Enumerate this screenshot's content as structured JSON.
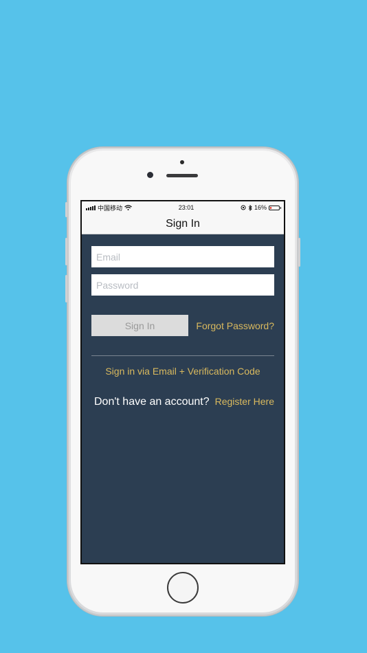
{
  "status_bar": {
    "carrier": "中国移动",
    "time": "23:01",
    "battery": "16%",
    "battery_level": 0.16
  },
  "nav": {
    "title": "Sign In"
  },
  "form": {
    "email_placeholder": "Email",
    "password_placeholder": "Password",
    "sign_in_label": "Sign In",
    "forgot_password_label": "Forgot Password?"
  },
  "alt_login": {
    "verification_link": "Sign in via Email + Verification Code"
  },
  "register": {
    "question": "Don't have an account?",
    "link": "Register Here"
  },
  "colors": {
    "background": "#56c2ea",
    "screen_background": "#2c3e52",
    "link": "#d9b95e",
    "button_disabled": "#dcdcdc"
  }
}
